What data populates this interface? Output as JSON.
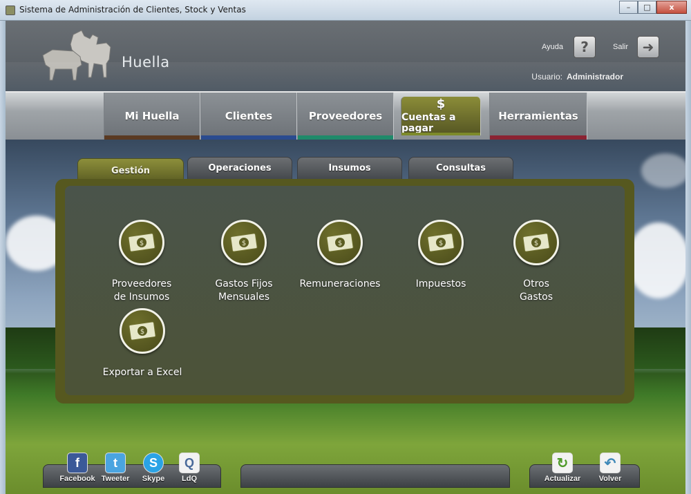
{
  "window": {
    "title": "Sistema de Administración de Clientes, Stock y Ventas",
    "minimize": "–",
    "maximize": "□",
    "close": "x"
  },
  "header": {
    "brand": "Huella",
    "help_label": "Ayuda",
    "help_icon": "?",
    "exit_label": "Salir",
    "exit_icon": "➜",
    "user_label": "Usuario:",
    "user_value": "Administrador"
  },
  "nav": {
    "items": [
      {
        "label": "Mi Huella",
        "color": "#5a3a22"
      },
      {
        "label": "Clientes",
        "color": "#2a4b8f"
      },
      {
        "label": "Proveedores",
        "color": "#1f8a6a"
      },
      {
        "label": "Cuentas a pagar",
        "color": "#7d8a2a",
        "icon": "$"
      },
      {
        "label": "Herramientas",
        "color": "#8b2332"
      }
    ]
  },
  "tabs": [
    {
      "label": "Gestión"
    },
    {
      "label": "Operaciones"
    },
    {
      "label": "Insumos"
    },
    {
      "label": "Consultas"
    }
  ],
  "actions": [
    {
      "label": "Proveedores\nde Insumos"
    },
    {
      "label": "Gastos Fijos\nMensuales"
    },
    {
      "label": "Remuneraciones"
    },
    {
      "label": "Impuestos"
    },
    {
      "label": "Otros\nGastos"
    },
    {
      "label": "Exportar a Excel"
    }
  ],
  "footer": {
    "facebook": "Facebook",
    "facebook_glyph": "f",
    "tweeter": "Tweeter",
    "tweeter_glyph": "t",
    "skype": "Skype",
    "skype_glyph": "S",
    "ldq": "LdQ",
    "ldq_glyph": "Q",
    "refresh": "Actualizar",
    "refresh_glyph": "↻",
    "back": "Volver",
    "back_glyph": "↶"
  },
  "colors": {
    "accent_olive": "#5b5d22",
    "facebook": "#3b5998",
    "twitter": "#4aa4e0",
    "skype": "#2aa3e6"
  }
}
